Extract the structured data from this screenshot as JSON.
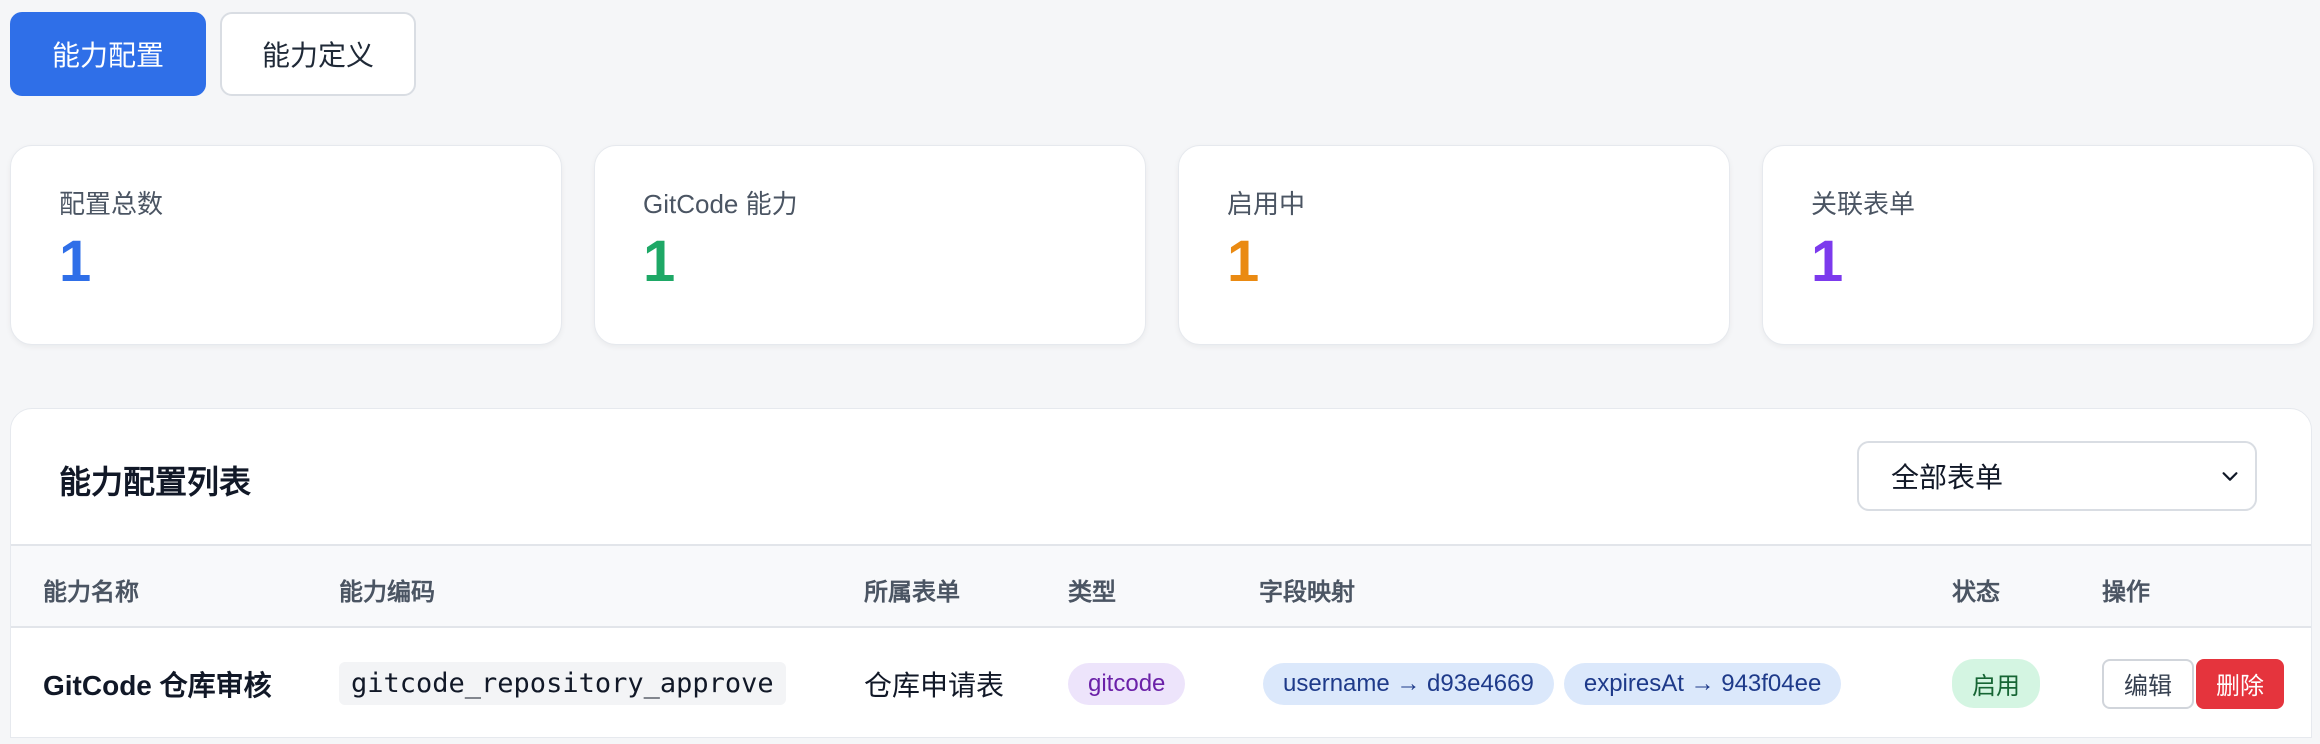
{
  "tabs": [
    {
      "label": "能力配置",
      "active": true
    },
    {
      "label": "能力定义",
      "active": false
    }
  ],
  "stats": [
    {
      "label": "配置总数",
      "value": "1",
      "color": "#2f6fe8"
    },
    {
      "label": "GitCode 能力",
      "value": "1",
      "color": "#1ea866"
    },
    {
      "label": "启用中",
      "value": "1",
      "color": "#ea8a12"
    },
    {
      "label": "关联表单",
      "value": "1",
      "color": "#7c3aed"
    }
  ],
  "panel": {
    "title": "能力配置列表",
    "filter": {
      "selected": "全部表单",
      "icon": "chevron-down-icon"
    }
  },
  "table": {
    "headers": [
      "能力名称",
      "能力编码",
      "所属表单",
      "类型",
      "字段映射",
      "状态",
      "操作"
    ],
    "rows": [
      {
        "name": "GitCode 仓库审核",
        "code": "gitcode_repository_approve",
        "form": "仓库申请表",
        "type": "gitcode",
        "mappings": [
          "username → d93e4669",
          "expiresAt → 943f04ee"
        ],
        "status": "启用",
        "actions": {
          "edit": "编辑",
          "delete": "删除"
        }
      }
    ]
  }
}
